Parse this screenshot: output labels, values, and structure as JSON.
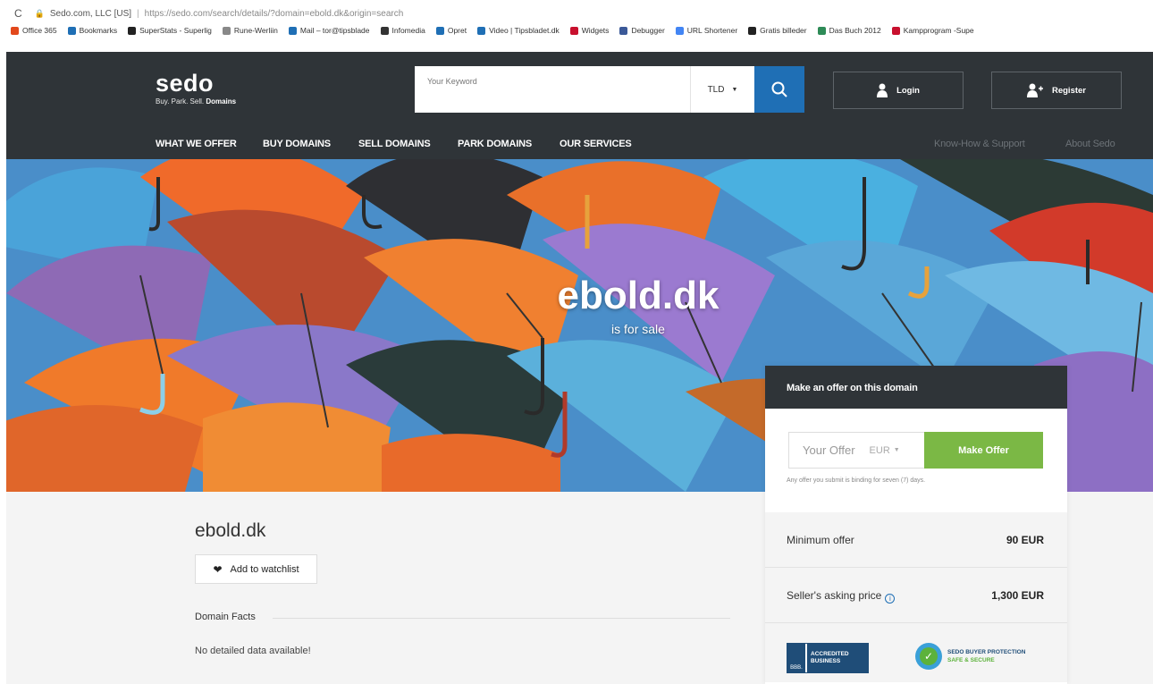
{
  "browser": {
    "tab_org": "Sedo.com, LLC [US]",
    "url": "https://sedo.com/search/details/?domain=ebold.dk&origin=search",
    "bookmarks": [
      {
        "label": "Office 365",
        "color": "#e2481c"
      },
      {
        "label": "Bookmarks",
        "color": "#1f6fb5"
      },
      {
        "label": "SuperStats - Superlig",
        "color": "#222222"
      },
      {
        "label": "Rune-Werliin",
        "color": "#888888"
      },
      {
        "label": "Mail – tor@tipsblade",
        "color": "#1f6fb5"
      },
      {
        "label": "Infomedia",
        "color": "#333333"
      },
      {
        "label": "Opret",
        "color": "#1f6fb5"
      },
      {
        "label": "Video | Tipsbladet.dk",
        "color": "#1f6fb5"
      },
      {
        "label": "Widgets",
        "color": "#c8102e"
      },
      {
        "label": "Debugger",
        "color": "#3b5998"
      },
      {
        "label": "URL Shortener",
        "color": "#4285f4"
      },
      {
        "label": "Gratis billeder",
        "color": "#222222"
      },
      {
        "label": "Das Buch 2012",
        "color": "#2e8b57"
      },
      {
        "label": "Kampprogram -Supe",
        "color": "#c8102e"
      }
    ]
  },
  "header": {
    "logo_name": "sedo",
    "logo_tag_prefix": "Buy. Park. Sell.",
    "logo_tag_bold": "Domains",
    "search_placeholder": "Your Keyword",
    "tld_label": "TLD",
    "login_label": "Login",
    "register_label": "Register"
  },
  "nav": {
    "what_we_offer": "WHAT WE OFFER",
    "buy_domains": "BUY DOMAINS",
    "sell_domains": "SELL DOMAINS",
    "park_domains": "PARK DOMAINS",
    "our_services": "OUR SERVICES",
    "know_how": "Know-How & Support",
    "about": "About Sedo"
  },
  "hero": {
    "domain": "ebold.dk",
    "subtitle": "is for sale"
  },
  "details": {
    "domain": "ebold.dk",
    "watchlist_label": "Add to watchlist",
    "facts_label": "Domain Facts",
    "no_data": "No detailed data available!"
  },
  "offer": {
    "heading": "Make an offer on this domain",
    "input_placeholder": "Your Offer",
    "currency": "EUR",
    "button_label": "Make Offer",
    "binding_note": "Any offer you submit is binding for seven (7) days.",
    "min_label": "Minimum offer",
    "min_value": "90 EUR",
    "asking_label": "Seller's asking price",
    "asking_value": "1,300 EUR",
    "bbb_seal": "BBB.",
    "bbb_text": "ACCREDITED BUSINESS",
    "protection_line1": "SEDO BUYER PROTECTION",
    "protection_line2": "SAFE & SECURE"
  },
  "colors": {
    "header_bg": "#2f3438",
    "search_blue": "#1f6fb5",
    "offer_green": "#7bb845"
  }
}
